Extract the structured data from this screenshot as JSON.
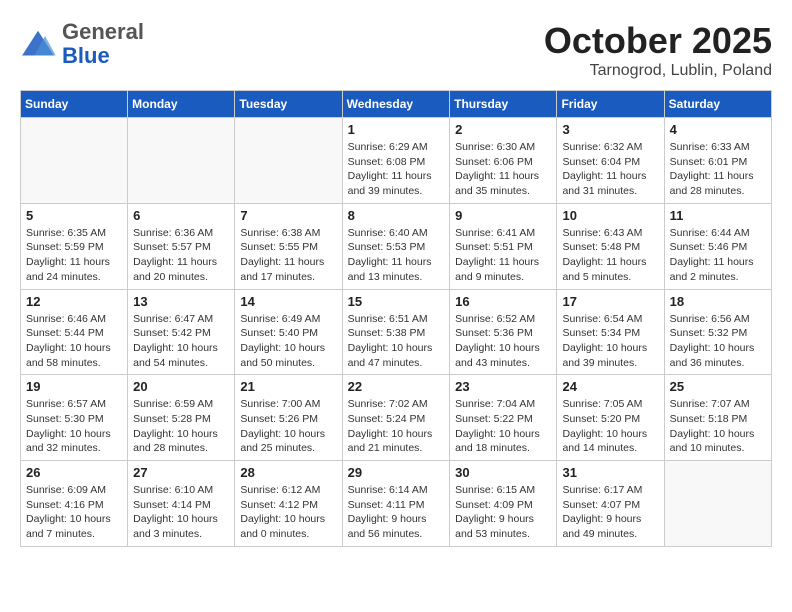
{
  "header": {
    "logo": {
      "general": "General",
      "blue": "Blue"
    },
    "title": "October 2025",
    "location": "Tarnogrod, Lublin, Poland"
  },
  "weekdays": [
    "Sunday",
    "Monday",
    "Tuesday",
    "Wednesday",
    "Thursday",
    "Friday",
    "Saturday"
  ],
  "weeks": [
    [
      {
        "day": "",
        "sunrise": "",
        "sunset": "",
        "daylight": ""
      },
      {
        "day": "",
        "sunrise": "",
        "sunset": "",
        "daylight": ""
      },
      {
        "day": "",
        "sunrise": "",
        "sunset": "",
        "daylight": ""
      },
      {
        "day": "1",
        "sunrise": "Sunrise: 6:29 AM",
        "sunset": "Sunset: 6:08 PM",
        "daylight": "Daylight: 11 hours and 39 minutes."
      },
      {
        "day": "2",
        "sunrise": "Sunrise: 6:30 AM",
        "sunset": "Sunset: 6:06 PM",
        "daylight": "Daylight: 11 hours and 35 minutes."
      },
      {
        "day": "3",
        "sunrise": "Sunrise: 6:32 AM",
        "sunset": "Sunset: 6:04 PM",
        "daylight": "Daylight: 11 hours and 31 minutes."
      },
      {
        "day": "4",
        "sunrise": "Sunrise: 6:33 AM",
        "sunset": "Sunset: 6:01 PM",
        "daylight": "Daylight: 11 hours and 28 minutes."
      }
    ],
    [
      {
        "day": "5",
        "sunrise": "Sunrise: 6:35 AM",
        "sunset": "Sunset: 5:59 PM",
        "daylight": "Daylight: 11 hours and 24 minutes."
      },
      {
        "day": "6",
        "sunrise": "Sunrise: 6:36 AM",
        "sunset": "Sunset: 5:57 PM",
        "daylight": "Daylight: 11 hours and 20 minutes."
      },
      {
        "day": "7",
        "sunrise": "Sunrise: 6:38 AM",
        "sunset": "Sunset: 5:55 PM",
        "daylight": "Daylight: 11 hours and 17 minutes."
      },
      {
        "day": "8",
        "sunrise": "Sunrise: 6:40 AM",
        "sunset": "Sunset: 5:53 PM",
        "daylight": "Daylight: 11 hours and 13 minutes."
      },
      {
        "day": "9",
        "sunrise": "Sunrise: 6:41 AM",
        "sunset": "Sunset: 5:51 PM",
        "daylight": "Daylight: 11 hours and 9 minutes."
      },
      {
        "day": "10",
        "sunrise": "Sunrise: 6:43 AM",
        "sunset": "Sunset: 5:48 PM",
        "daylight": "Daylight: 11 hours and 5 minutes."
      },
      {
        "day": "11",
        "sunrise": "Sunrise: 6:44 AM",
        "sunset": "Sunset: 5:46 PM",
        "daylight": "Daylight: 11 hours and 2 minutes."
      }
    ],
    [
      {
        "day": "12",
        "sunrise": "Sunrise: 6:46 AM",
        "sunset": "Sunset: 5:44 PM",
        "daylight": "Daylight: 10 hours and 58 minutes."
      },
      {
        "day": "13",
        "sunrise": "Sunrise: 6:47 AM",
        "sunset": "Sunset: 5:42 PM",
        "daylight": "Daylight: 10 hours and 54 minutes."
      },
      {
        "day": "14",
        "sunrise": "Sunrise: 6:49 AM",
        "sunset": "Sunset: 5:40 PM",
        "daylight": "Daylight: 10 hours and 50 minutes."
      },
      {
        "day": "15",
        "sunrise": "Sunrise: 6:51 AM",
        "sunset": "Sunset: 5:38 PM",
        "daylight": "Daylight: 10 hours and 47 minutes."
      },
      {
        "day": "16",
        "sunrise": "Sunrise: 6:52 AM",
        "sunset": "Sunset: 5:36 PM",
        "daylight": "Daylight: 10 hours and 43 minutes."
      },
      {
        "day": "17",
        "sunrise": "Sunrise: 6:54 AM",
        "sunset": "Sunset: 5:34 PM",
        "daylight": "Daylight: 10 hours and 39 minutes."
      },
      {
        "day": "18",
        "sunrise": "Sunrise: 6:56 AM",
        "sunset": "Sunset: 5:32 PM",
        "daylight": "Daylight: 10 hours and 36 minutes."
      }
    ],
    [
      {
        "day": "19",
        "sunrise": "Sunrise: 6:57 AM",
        "sunset": "Sunset: 5:30 PM",
        "daylight": "Daylight: 10 hours and 32 minutes."
      },
      {
        "day": "20",
        "sunrise": "Sunrise: 6:59 AM",
        "sunset": "Sunset: 5:28 PM",
        "daylight": "Daylight: 10 hours and 28 minutes."
      },
      {
        "day": "21",
        "sunrise": "Sunrise: 7:00 AM",
        "sunset": "Sunset: 5:26 PM",
        "daylight": "Daylight: 10 hours and 25 minutes."
      },
      {
        "day": "22",
        "sunrise": "Sunrise: 7:02 AM",
        "sunset": "Sunset: 5:24 PM",
        "daylight": "Daylight: 10 hours and 21 minutes."
      },
      {
        "day": "23",
        "sunrise": "Sunrise: 7:04 AM",
        "sunset": "Sunset: 5:22 PM",
        "daylight": "Daylight: 10 hours and 18 minutes."
      },
      {
        "day": "24",
        "sunrise": "Sunrise: 7:05 AM",
        "sunset": "Sunset: 5:20 PM",
        "daylight": "Daylight: 10 hours and 14 minutes."
      },
      {
        "day": "25",
        "sunrise": "Sunrise: 7:07 AM",
        "sunset": "Sunset: 5:18 PM",
        "daylight": "Daylight: 10 hours and 10 minutes."
      }
    ],
    [
      {
        "day": "26",
        "sunrise": "Sunrise: 6:09 AM",
        "sunset": "Sunset: 4:16 PM",
        "daylight": "Daylight: 10 hours and 7 minutes."
      },
      {
        "day": "27",
        "sunrise": "Sunrise: 6:10 AM",
        "sunset": "Sunset: 4:14 PM",
        "daylight": "Daylight: 10 hours and 3 minutes."
      },
      {
        "day": "28",
        "sunrise": "Sunrise: 6:12 AM",
        "sunset": "Sunset: 4:12 PM",
        "daylight": "Daylight: 10 hours and 0 minutes."
      },
      {
        "day": "29",
        "sunrise": "Sunrise: 6:14 AM",
        "sunset": "Sunset: 4:11 PM",
        "daylight": "Daylight: 9 hours and 56 minutes."
      },
      {
        "day": "30",
        "sunrise": "Sunrise: 6:15 AM",
        "sunset": "Sunset: 4:09 PM",
        "daylight": "Daylight: 9 hours and 53 minutes."
      },
      {
        "day": "31",
        "sunrise": "Sunrise: 6:17 AM",
        "sunset": "Sunset: 4:07 PM",
        "daylight": "Daylight: 9 hours and 49 minutes."
      },
      {
        "day": "",
        "sunrise": "",
        "sunset": "",
        "daylight": ""
      }
    ]
  ]
}
